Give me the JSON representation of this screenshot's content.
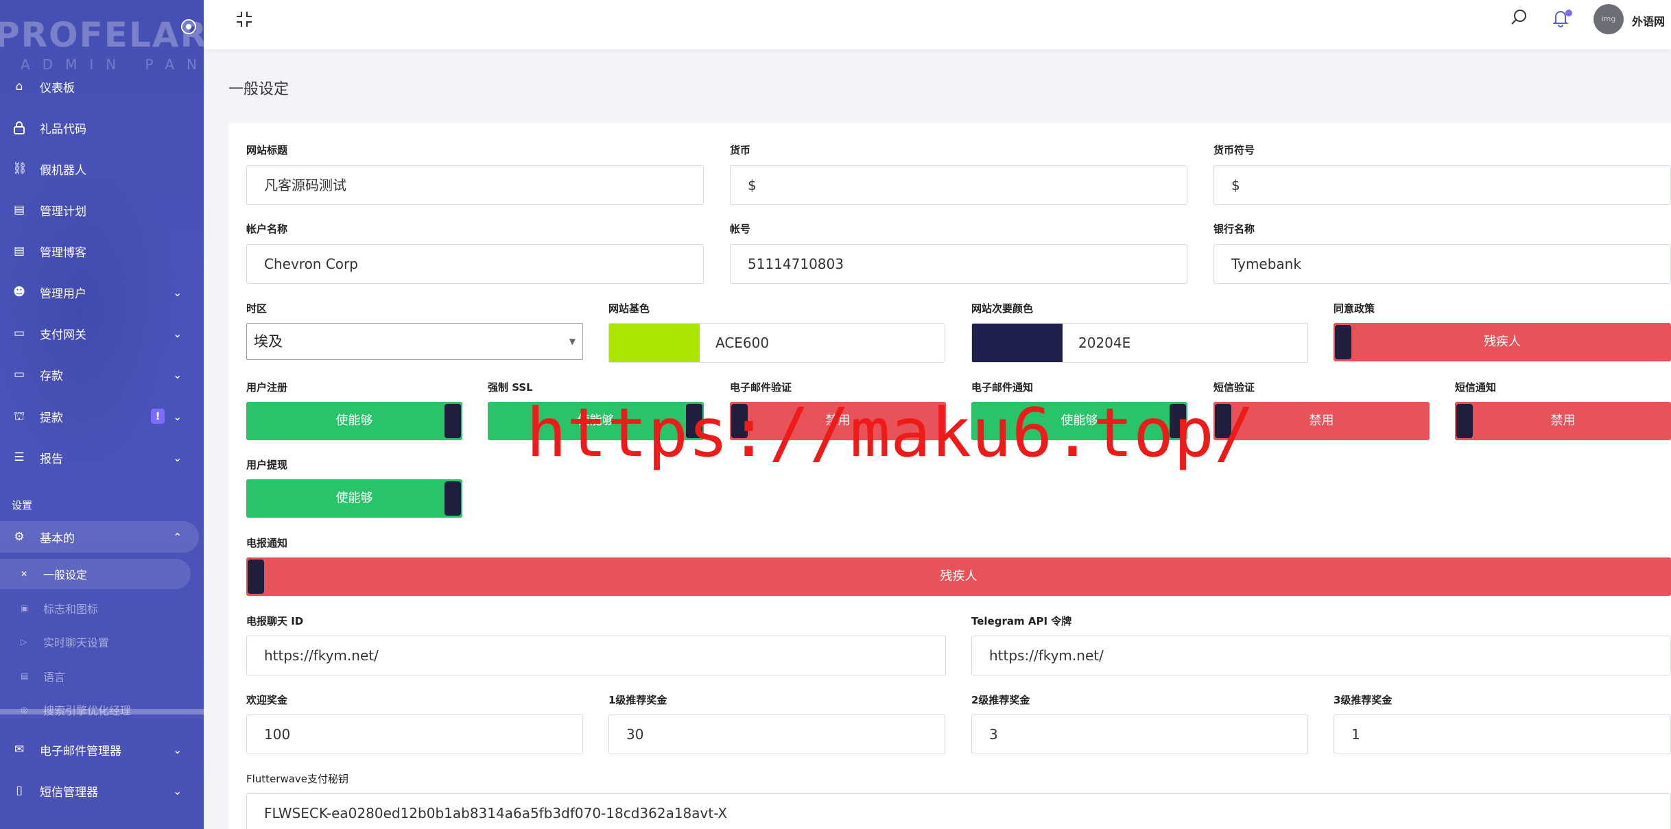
{
  "sidebar": {
    "brand": "PROFELAR",
    "brand_sub": "ADMIN PANEL",
    "items": [
      {
        "label": "仪表板",
        "icon": "home-icon"
      },
      {
        "label": "礼品代码",
        "icon": "lock-icon"
      },
      {
        "label": "假机器人",
        "icon": "link-icon"
      },
      {
        "label": "管理计划",
        "icon": "table-icon"
      },
      {
        "label": "管理博客",
        "icon": "table-icon"
      },
      {
        "label": "管理用户",
        "icon": "users-icon"
      },
      {
        "label": "支付网关",
        "icon": "card-icon"
      },
      {
        "label": "存款",
        "icon": "wallet-icon"
      },
      {
        "label": "提款",
        "icon": "bank-icon",
        "badge": "!"
      },
      {
        "label": "报告",
        "icon": "list-icon"
      }
    ],
    "section_label": "设置",
    "settings_parent": "基本的",
    "settings_sub": [
      "一般设定",
      "标志和图标",
      "实时聊天设置",
      "语言",
      "搜索引擎优化经理"
    ],
    "bottom_items": [
      {
        "label": "电子邮件管理器",
        "icon": "mail-icon"
      },
      {
        "label": "短信管理器",
        "icon": "phone-icon"
      }
    ]
  },
  "topbar": {
    "user_name": "外语网",
    "avatar_text": "img"
  },
  "page": {
    "title": "一般设定"
  },
  "form": {
    "site_title": {
      "label": "网站标题",
      "value": "凡客源码测试"
    },
    "currency": {
      "label": "货币",
      "value": "$"
    },
    "currency_symbol": {
      "label": "货币符号",
      "value": "$"
    },
    "account_name": {
      "label": "帐户名称",
      "value": "Chevron Corp"
    },
    "account_number": {
      "label": "帐号",
      "value": "51114710803"
    },
    "bank_name": {
      "label": "银行名称",
      "value": "Tymebank"
    },
    "timezone": {
      "label": "时区",
      "value": "埃及"
    },
    "base_color": {
      "label": "网站基色",
      "value": "ACE600",
      "swatch": "#ACE600"
    },
    "secondary_color": {
      "label": "网站次要颜色",
      "value": "20204E",
      "swatch": "#20204E"
    },
    "agree_policy": {
      "label": "同意政策",
      "state": "残疾人"
    },
    "user_registration": {
      "label": "用户注册",
      "state": "使能够"
    },
    "force_ssl": {
      "label": "强制 SSL",
      "state": "使能够"
    },
    "email_verification": {
      "label": "电子邮件验证",
      "state": "禁用"
    },
    "email_notification": {
      "label": "电子邮件通知",
      "state": "使能够"
    },
    "sms_verification": {
      "label": "短信验证",
      "state": "禁用"
    },
    "sms_notification": {
      "label": "短信通知",
      "state": "禁用"
    },
    "user_withdraw": {
      "label": "用户提现",
      "state": "使能够"
    },
    "telegram_notification": {
      "label": "电报通知",
      "state": "残疾人"
    },
    "telegram_chat_id": {
      "label": "电报聊天 ID",
      "value": "https://fkym.net/"
    },
    "telegram_api_token": {
      "label": "Telegram API 令牌",
      "value": "https://fkym.net/"
    },
    "welcome_bonus": {
      "label": "欢迎奖金",
      "value": "100"
    },
    "ref_bonus_1": {
      "label": "1级推荐奖金",
      "value": "30"
    },
    "ref_bonus_2": {
      "label": "2级推荐奖金",
      "value": "3"
    },
    "ref_bonus_3": {
      "label": "3级推荐奖金",
      "value": "1"
    },
    "flutterwave_secret": {
      "label": "Flutterwave支付秘钥",
      "value": "FLWSECK-ea0280ed12b0b1ab8314a6a5fb3df070-18cd362a18avt-X"
    }
  },
  "watermark": "https://maku6.top/",
  "colors": {
    "sidebar": "#4a52b6",
    "enabled": "#29c36a",
    "disabled": "#e8535a",
    "knob": "#1d1f3d",
    "accent": "#7f6bff"
  }
}
